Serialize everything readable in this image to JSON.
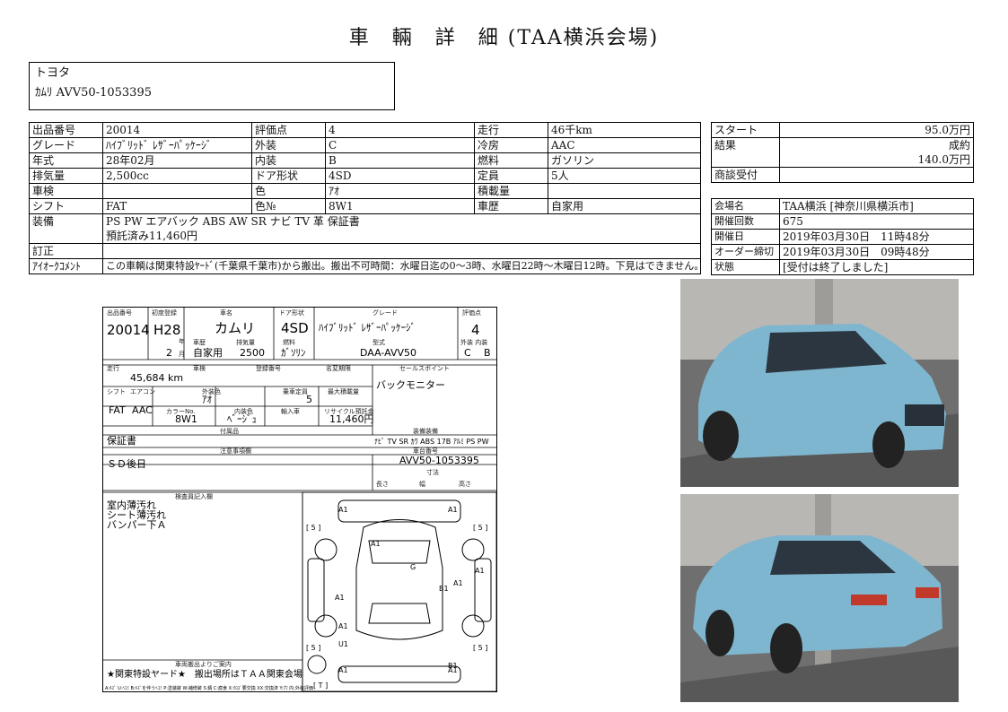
{
  "title": "車　輛　詳　細 (TAA横浜会場)",
  "vehicle": {
    "maker": "トヨタ",
    "model_line": "ｶﾑﾘ AVV50-1053395"
  },
  "spec": {
    "rows": [
      [
        "出品番号",
        "20014",
        "評価点",
        "4",
        "走行",
        "46千km"
      ],
      [
        "グレード",
        "ﾊｲﾌﾞﾘｯﾄﾞ ﾚｻﾞｰﾊﾟｯｹｰｼﾞ",
        "外装",
        "C",
        "冷房",
        "AAC"
      ],
      [
        "年式",
        "28年02月",
        "内装",
        "B",
        "燃料",
        "ガソリン"
      ],
      [
        "排気量",
        "2,500cc",
        "ドア形状",
        "4SD",
        "定員",
        "5人"
      ],
      [
        "車検",
        "",
        "色",
        "ｱｵ",
        "積載量",
        ""
      ],
      [
        "シフト",
        "FAT",
        "色№",
        "8W1",
        "車歴",
        "自家用"
      ]
    ],
    "equipment_label": "装備",
    "equipment_line1": "PS PW エアバック ABS AW SR ナビ TV 革 保証書",
    "equipment_line2": "預託済み11,460円",
    "correction_label": "訂正",
    "comment_label": "ｱｲｵｰｸｺﾒﾝﾄ",
    "comment": "この車輌は関東特設ﾔｰﾄﾞ(千葉県千葉市)から搬出。搬出不可時間：水曜日迄の0～3時、水曜日22時～木曜日12時。下見はできません。"
  },
  "price": {
    "start_label": "スタート",
    "start_value": "95.0万円",
    "result_label": "結果",
    "result_status": "成約",
    "result_value": "140.0万円",
    "negotiation_label": "商談受付",
    "negotiation_value": ""
  },
  "venue": {
    "rows": [
      [
        "会場名",
        "TAA横浜 [神奈川県横浜市]"
      ],
      [
        "開催回数",
        "675"
      ],
      [
        "開催日",
        "2019年03月30日　11時48分"
      ],
      [
        "オーダー締切",
        "2019年03月30日　09時48分"
      ],
      [
        "状態",
        "[受付は終了しました]"
      ]
    ]
  },
  "sheet": {
    "header": {
      "lot_no": "20014",
      "first_reg": "H28",
      "reg_month": "2",
      "car_name": "カムリ",
      "door_type": "4SD",
      "grade": "ﾊｲﾌﾞﾘｯﾄﾞ ﾚｻﾞｰﾊﾟｯｹｰｼﾞ",
      "score": "4",
      "use": "自家用",
      "displacement": "2500",
      "fuel": "ｶﾞｿﾘﾝ",
      "model_code": "DAA-AVV50",
      "ext_grade": "C",
      "int_grade": "B",
      "mileage": "45,684 km",
      "shift": "FAT",
      "aircon": "AAC",
      "color": "ｱｵ",
      "capacity": "5",
      "color_no": "8W1",
      "interior_color": "ﾍﾞｰｼﾞｭ",
      "recycle_fee": "11,460円",
      "sales_point": "バックモニター",
      "options": "ﾅﾋﾞ TV SR ｶﾜ ABS 17B ｱﾙﾐ PS PW",
      "accessories": "保証書",
      "chassis_no": "AVV50-1053395",
      "inspector_notes": "ＳＤ後日",
      "inspector_memo": [
        "室内薄汚れ",
        "シート薄汚れ",
        "バンパー下Ａ"
      ],
      "transport_note": "★関東特設ヤード★　搬出場所はＴＡＡ関東会場"
    },
    "labels": {
      "lot": "出品番号",
      "first_reg": "初度登録",
      "car_name": "車名",
      "door": "ドア形状",
      "grade": "グレード",
      "score": "評価点",
      "month": "月",
      "year": "年",
      "use": "車歴",
      "displacement": "排気量",
      "fuel": "燃料",
      "model": "型式",
      "ext_int": "外装 内装",
      "mileage": "走行",
      "inspection": "車検",
      "reg_no": "登録番号",
      "transfer": "名変期限",
      "sales_point": "セールスポイント",
      "shift": "シフト",
      "aircon": "エアコン",
      "ext_color": "外装色",
      "capacity": "乗車定員",
      "max_load": "最大積載量",
      "color_no": "カラーNo.",
      "int_color": "内装色",
      "import": "輸入車",
      "recycle": "リサイクル預託金",
      "equipment": "装備装備",
      "acc": "付属品",
      "notes": "注意事項欄",
      "chassis": "車台番号",
      "dims": "寸法",
      "length": "長さ",
      "width": "幅",
      "height": "高さ",
      "inspector": "検査員記入欄",
      "transport": "車両搬出よりご案内",
      "legend": "A:ｷｽﾞ U:ﾍｺﾐ B:ｷｽﾞを伴うﾍｺﾐ P:塗装跡 W:補修跡 S:錆 C:腐食 X:ｸﾛｽﾞ要交換 XX:交換済 Y:穴 内:外装評価"
    },
    "diagram_marks": {
      "top": [
        "A1",
        "A1",
        "A1",
        "A1"
      ],
      "side": [
        "A1",
        "G",
        "A1",
        "B1",
        "A1",
        "A1",
        "A1",
        "U1",
        "B1"
      ],
      "brackets": [
        "[ 5 ]",
        "[ 5 ]",
        "[ 5 ]",
        "[ 5 ]",
        "[ T ]"
      ]
    }
  },
  "photos": {
    "front_alt": "front-three-quarter",
    "rear_alt": "rear-three-quarter"
  },
  "colors": {
    "car_body": "#7fb6cf",
    "garage": "#8a8a8a"
  }
}
